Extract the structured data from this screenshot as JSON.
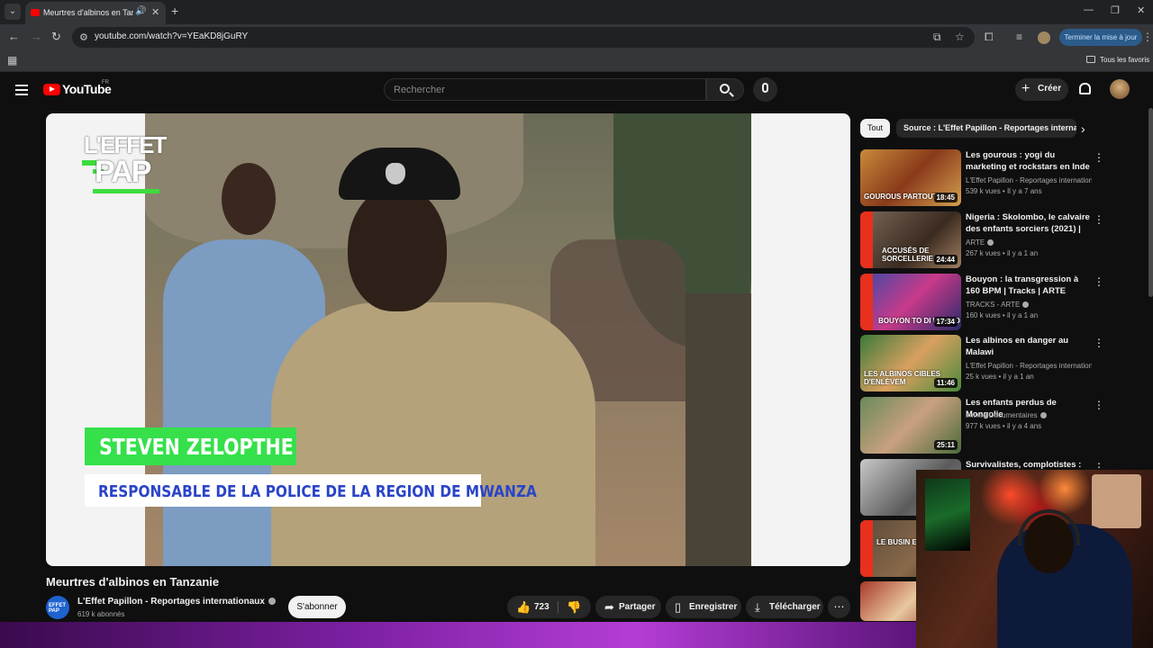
{
  "browser": {
    "tab_title": "Meurtres d'albinos en Tanzanie",
    "url": "youtube.com/watch?v=YEaKD8jGuRY",
    "update_button": "Terminer la mise à jour",
    "bookmarks_all": "Tous les favoris"
  },
  "youtube": {
    "logo_text": "YouTube",
    "country_code": "FR",
    "search_placeholder": "Rechercher",
    "create_label": "Créer"
  },
  "video": {
    "title": "Meurtres d'albinos en Tanzanie",
    "overlay_logo_top": "L'EFFET",
    "overlay_logo_bottom": "PAP",
    "lower_third_name": "STEVEN ZELOPTHE",
    "lower_third_role": "RESPONSABLE DE LA POLICE DE LA REGION DE MWANZA",
    "channel_name": "L'Effet Papillon - Reportages internationaux",
    "channel_avatar_text": "EFFET PAP",
    "subscribers": "619 k abonnés",
    "subscribe_label": "S'abonner",
    "likes": "723",
    "share_label": "Partager",
    "save_label": "Enregistrer",
    "download_label": "Télécharger"
  },
  "sidebar": {
    "chips": [
      "Tout",
      "Source : L'Effet Papillon - Reportages internationaux"
    ],
    "recommendations": [
      {
        "title": "Les gourous : yogi du marketing et rockstars en Inde",
        "channel": "L'Effet Papillon - Reportages internationa...",
        "meta": "539 k vues • Il y a 7 ans",
        "duration": "18:45",
        "overlay": "GOUROUS PARTOUT",
        "verified": false
      },
      {
        "title": "Nigeria : Skolombo, le calvaire des enfants sorciers (2021) | ...",
        "channel": "ARTE",
        "meta": "267 k vues • il y a 1 an",
        "duration": "24:44",
        "overlay": "ACCUSÉS DE SORCELLERIE",
        "verified": true
      },
      {
        "title": "Bouyon : la transgression à 160 BPM | Tracks | ARTE",
        "channel": "TRACKS - ARTE",
        "meta": "160 k vues • il y a 1 an",
        "duration": "17:34",
        "overlay": "BOUYON TO DI WORLD",
        "verified": true
      },
      {
        "title": "Les albinos en danger au Malawi",
        "channel": "L'Effet Papillon - Reportages internationa...",
        "meta": "25 k vues • il y a 1 an",
        "duration": "11:46",
        "overlay": "LES ALBINOS CIBLES D'ENLÈVEM",
        "verified": false
      },
      {
        "title": "Les enfants perdus de Mongolie",
        "channel": "imineo Documentaires",
        "meta": "977 k vues • il y a 4 ans",
        "duration": "25:11",
        "overlay": "",
        "verified": true
      },
      {
        "title": "Survivalistes, complotistes : la",
        "channel": "",
        "meta": "",
        "duration": "",
        "overlay": "",
        "verified": false
      },
      {
        "title": "",
        "channel": "",
        "meta": "",
        "duration": "",
        "overlay": "LE BUSIN ENLÈVEN",
        "verified": false
      }
    ]
  },
  "colors": {
    "yt_red": "#ff0000",
    "lower_third_green": "#35e04a",
    "lower_third_blue_text": "#2a44c8",
    "update_button_bg": "#2b5b8a"
  }
}
